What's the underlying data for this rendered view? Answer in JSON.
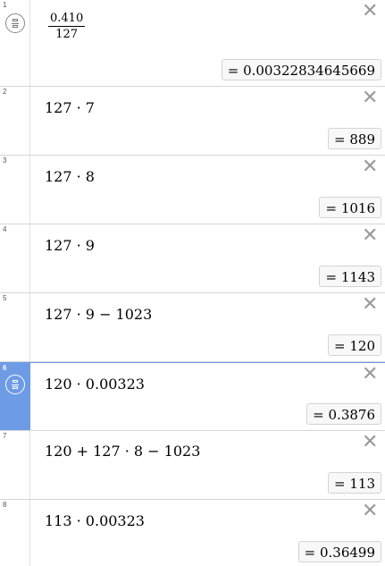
{
  "expressions": [
    {
      "index": "1",
      "numerator": "0.410",
      "denominator": "127",
      "result": "= 0.00322834645669",
      "close": "✕"
    },
    {
      "index": "2",
      "text": "127 · 7",
      "result": "= 889",
      "close": "✕"
    },
    {
      "index": "3",
      "text": "127 · 8",
      "result": "= 1016",
      "close": "✕"
    },
    {
      "index": "4",
      "text": "127 · 9",
      "result": "= 1143",
      "close": "✕"
    },
    {
      "index": "5",
      "text": "127 · 9 − 1023",
      "result": "= 120",
      "close": "✕"
    },
    {
      "index": "6",
      "text": "120 · 0.00323",
      "result": "= 0.3876",
      "close": "✕"
    },
    {
      "index": "7",
      "text": "120 + 127 · 8 − 1023",
      "result": "= 113",
      "close": "✕"
    },
    {
      "index": "8",
      "text": "113 · 0.00323",
      "result": "= 0.36499",
      "close": "✕"
    }
  ],
  "colors": {
    "active_gutter": "#6d9be6",
    "divider": "#d6d6d6"
  },
  "icons": {
    "fraction_toggle": "fraction-icon",
    "delete": "close-icon"
  }
}
